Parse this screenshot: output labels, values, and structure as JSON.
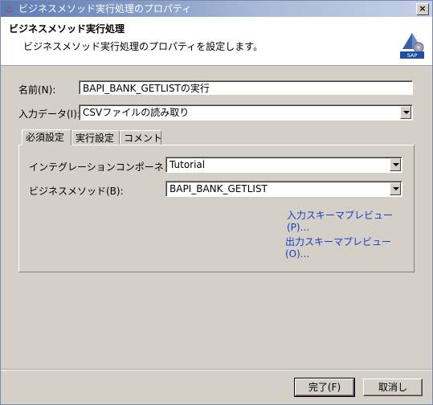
{
  "window": {
    "title": "ビジネスメソッド実行処理のプロパティ",
    "close_label": "×"
  },
  "banner": {
    "heading": "ビジネスメソッド実行処理",
    "description": "ビジネスメソッド実行処理のプロパティを設定します。",
    "logo_text": "SAP"
  },
  "form": {
    "name_label": "名前(N):",
    "name_value": "BAPI_BANK_GETLISTの実行",
    "input_data_label": "入力データ(I):",
    "input_data_value": "CSVファイルの読み取り"
  },
  "tabs": [
    {
      "label": "必須設定"
    },
    {
      "label": "実行設定"
    },
    {
      "label": "コメント"
    }
  ],
  "panel": {
    "component_label": "インテグレーションコンポーネント(O):",
    "component_value": "Tutorial",
    "method_label": "ビジネスメソッド(B):",
    "method_value": "BAPI_BANK_GETLIST",
    "input_schema_link": "入力スキーマプレビュー(P)...",
    "output_schema_link": "出力スキーマプレビュー(O)..."
  },
  "buttons": {
    "finish": "完了(F)",
    "cancel": "取消し"
  },
  "colors": {
    "link": "#1a3cc8",
    "dialog_bg": "#d4d0c8",
    "title_bar": "#5d7ab3"
  }
}
